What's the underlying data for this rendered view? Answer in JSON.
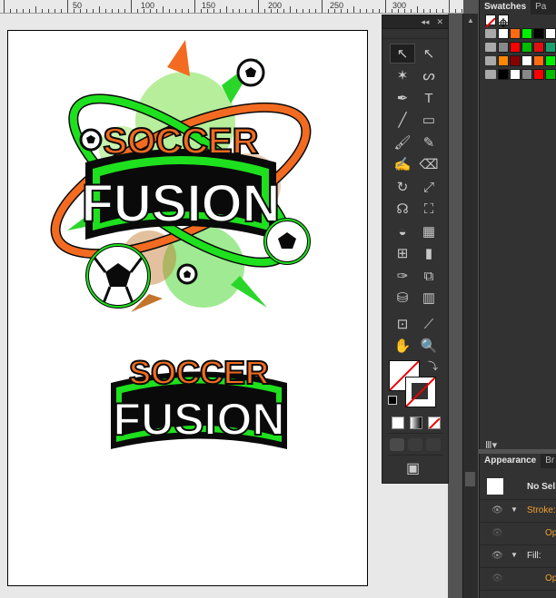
{
  "ruler": {
    "labels": [
      "50",
      "100",
      "150",
      "200",
      "250",
      "300"
    ]
  },
  "tools_panel": {
    "collapse_glyph": "◂◂",
    "close_glyph": "✕",
    "tools": [
      {
        "name": "selection-tool-icon",
        "glyph": "↖"
      },
      {
        "name": "direct-selection-tool-icon",
        "glyph": "↖"
      },
      {
        "name": "magic-wand-tool-icon",
        "glyph": "✶"
      },
      {
        "name": "lasso-tool-icon",
        "glyph": "ᔕ"
      },
      {
        "name": "pen-tool-icon",
        "glyph": "✒"
      },
      {
        "name": "type-tool-icon",
        "glyph": "T"
      },
      {
        "name": "line-tool-icon",
        "glyph": "╱"
      },
      {
        "name": "rectangle-tool-icon",
        "glyph": "▭"
      },
      {
        "name": "paintbrush-tool-icon",
        "glyph": "🖌"
      },
      {
        "name": "pencil-tool-icon",
        "glyph": "✎"
      },
      {
        "name": "blob-brush-tool-icon",
        "glyph": "✍"
      },
      {
        "name": "eraser-tool-icon",
        "glyph": "⌫"
      },
      {
        "name": "rotate-tool-icon",
        "glyph": "↻"
      },
      {
        "name": "scale-tool-icon",
        "glyph": "⤢"
      },
      {
        "name": "warp-tool-icon",
        "glyph": "☊"
      },
      {
        "name": "free-transform-tool-icon",
        "glyph": "⛶"
      },
      {
        "name": "shape-builder-tool-icon",
        "glyph": "◒"
      },
      {
        "name": "perspective-grid-tool-icon",
        "glyph": "▦"
      },
      {
        "name": "mesh-tool-icon",
        "glyph": "⊞"
      },
      {
        "name": "gradient-tool-icon",
        "glyph": "▮"
      },
      {
        "name": "eyedropper-tool-icon",
        "glyph": "✑"
      },
      {
        "name": "blend-tool-icon",
        "glyph": "⧉"
      },
      {
        "name": "symbol-sprayer-tool-icon",
        "glyph": "⛁"
      },
      {
        "name": "column-graph-tool-icon",
        "glyph": "▥"
      },
      {
        "name": "artboard-tool-icon",
        "glyph": "⊡"
      },
      {
        "name": "slice-tool-icon",
        "glyph": "⟋"
      },
      {
        "name": "hand-tool-icon",
        "glyph": "✋"
      },
      {
        "name": "zoom-tool-icon",
        "glyph": "🔍"
      }
    ],
    "mode_buttons": [
      "color-mode-icon",
      "gradient-mode-icon",
      "none-mode-icon"
    ],
    "draw_modes": [
      "draw-normal-icon",
      "draw-behind-icon",
      "draw-inside-icon"
    ],
    "screen_mode_glyph": "▣"
  },
  "swatches_panel": {
    "tabs": [
      "Swatches",
      "Pa"
    ],
    "colors": [
      "#ffffff",
      "#ff6a13",
      "#00ee00",
      "#000000",
      "#ffffff",
      "#888888",
      "#ff0000",
      "#00bb00",
      "#e01010",
      "#1aa070",
      "#ff8800",
      "#880000"
    ],
    "library_glyph": "Ⅲ▾"
  },
  "appearance_panel": {
    "tabs": [
      "Appearance",
      "Br"
    ],
    "selection_label": "No Sel",
    "stroke_label": "Stroke:",
    "fill_label": "Fill:",
    "opacity_label": "Op",
    "eye_glyph": "👁",
    "expand_glyph": "▼"
  },
  "artwork": {
    "big_logo": {
      "top_word": "SOCCER",
      "bottom_word": "FUSION"
    },
    "small_logo": {
      "top_word": "SOCCER",
      "bottom_word": "FUSION"
    },
    "colors": {
      "orange": "#f26b21",
      "green": "#1ee01e",
      "black": "#0a0a0a"
    }
  }
}
